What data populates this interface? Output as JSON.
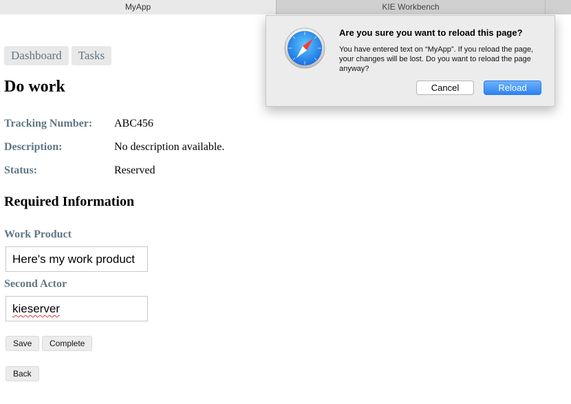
{
  "browser": {
    "tabs": [
      {
        "label": "MyApp",
        "active": true
      },
      {
        "label": "KIE Workbench",
        "active": false
      }
    ]
  },
  "nav": {
    "dashboard_label": "Dashboard",
    "tasks_label": "Tasks"
  },
  "page": {
    "title": "Do work",
    "fields": [
      {
        "label": "Tracking Number:",
        "value": "ABC456"
      },
      {
        "label": "Description:",
        "value": "No description available."
      },
      {
        "label": "Status:",
        "value": "Reserved"
      }
    ],
    "section_title": "Required Information",
    "inputs": [
      {
        "label": "Work Product",
        "value": "Here's my work product"
      },
      {
        "label": "Second Actor",
        "value": "kieserver"
      }
    ],
    "buttons": {
      "save": "Save",
      "complete": "Complete",
      "back": "Back"
    }
  },
  "dialog": {
    "title": "Are you sure you want to reload this page?",
    "message": "You have entered text on “MyApp”. If you reload the page, your changes will be lost. Do you want to reload the page anyway?",
    "cancel_label": "Cancel",
    "reload_label": "Reload",
    "icon": "safari-compass-icon",
    "accent_color": "#2e83f3"
  }
}
